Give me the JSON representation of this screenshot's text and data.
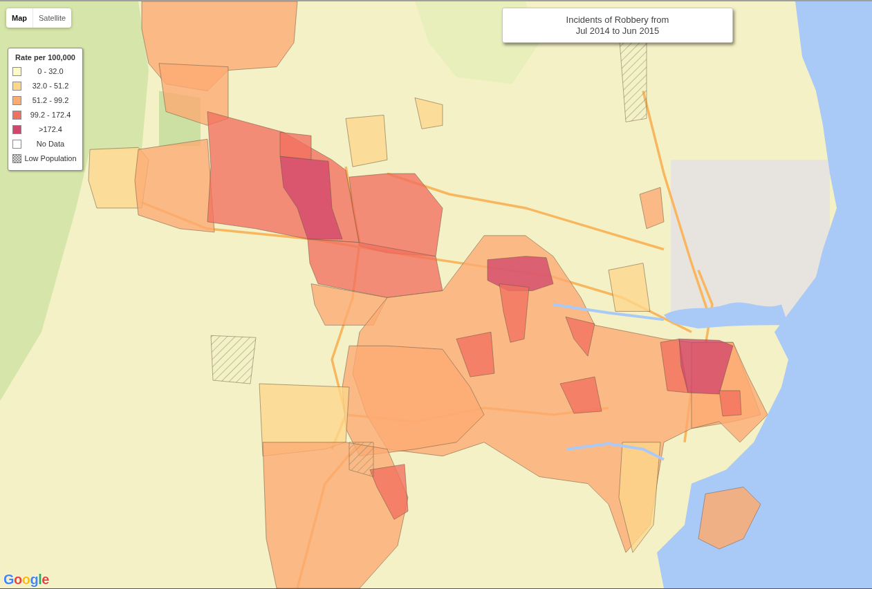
{
  "map_type_control": [
    {
      "label": "Map",
      "selected": true
    },
    {
      "label": "Satellite",
      "selected": false
    }
  ],
  "legend": {
    "title": "Rate per 100,000",
    "items": [
      {
        "label": "0 - 32.0",
        "kind": "solid",
        "color": "#fdfac6"
      },
      {
        "label": "32.0 - 51.2",
        "kind": "solid",
        "color": "#fdd68a"
      },
      {
        "label": "51.2 - 99.2",
        "kind": "solid",
        "color": "#fcab72"
      },
      {
        "label": "99.2 - 172.4",
        "kind": "solid",
        "color": "#f2705f"
      },
      {
        "label": ">172.4",
        "kind": "solid",
        "color": "#d2466b"
      },
      {
        "label": "No Data",
        "kind": "solid",
        "color": "#ffffff"
      },
      {
        "label": "Low Population",
        "kind": "pattern"
      }
    ]
  },
  "title": {
    "lines": [
      "Incidents of Robbery from",
      "Jul 2014 to Jun 2015"
    ]
  },
  "logo": "Google"
}
